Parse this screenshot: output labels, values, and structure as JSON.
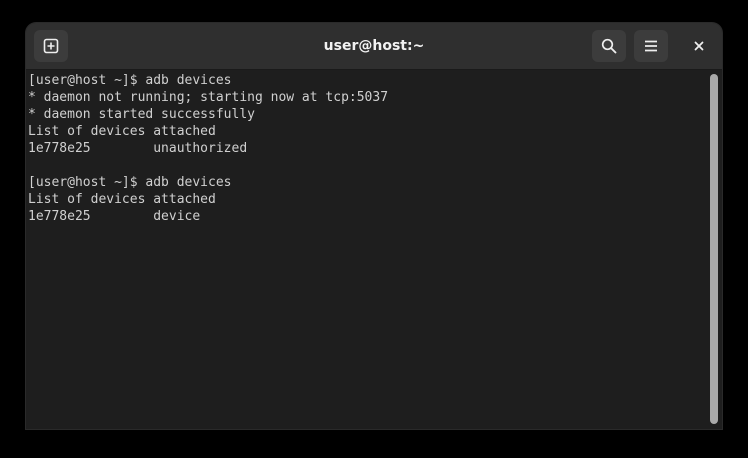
{
  "window": {
    "title": "user@host:~"
  },
  "headerbar": {
    "new_tab_icon": "new-tab-icon",
    "search_icon": "search-icon",
    "menu_icon": "hamburger-menu-icon",
    "close_icon": "close-icon"
  },
  "terminal": {
    "lines": [
      "[user@host ~]$ adb devices",
      "* daemon not running; starting now at tcp:5037",
      "* daemon started successfully",
      "List of devices attached",
      "1e778e25        unauthorized",
      "",
      "[user@host ~]$ adb devices",
      "List of devices attached",
      "1e778e25        device"
    ]
  },
  "colors": {
    "background": "#000000",
    "terminal_bg": "#1e1e1e",
    "headerbar_bg": "#2f2f2f",
    "text": "#d0d0d0",
    "button_bg": "#3c3c3c",
    "scrollbar": "#a9a9a9"
  }
}
